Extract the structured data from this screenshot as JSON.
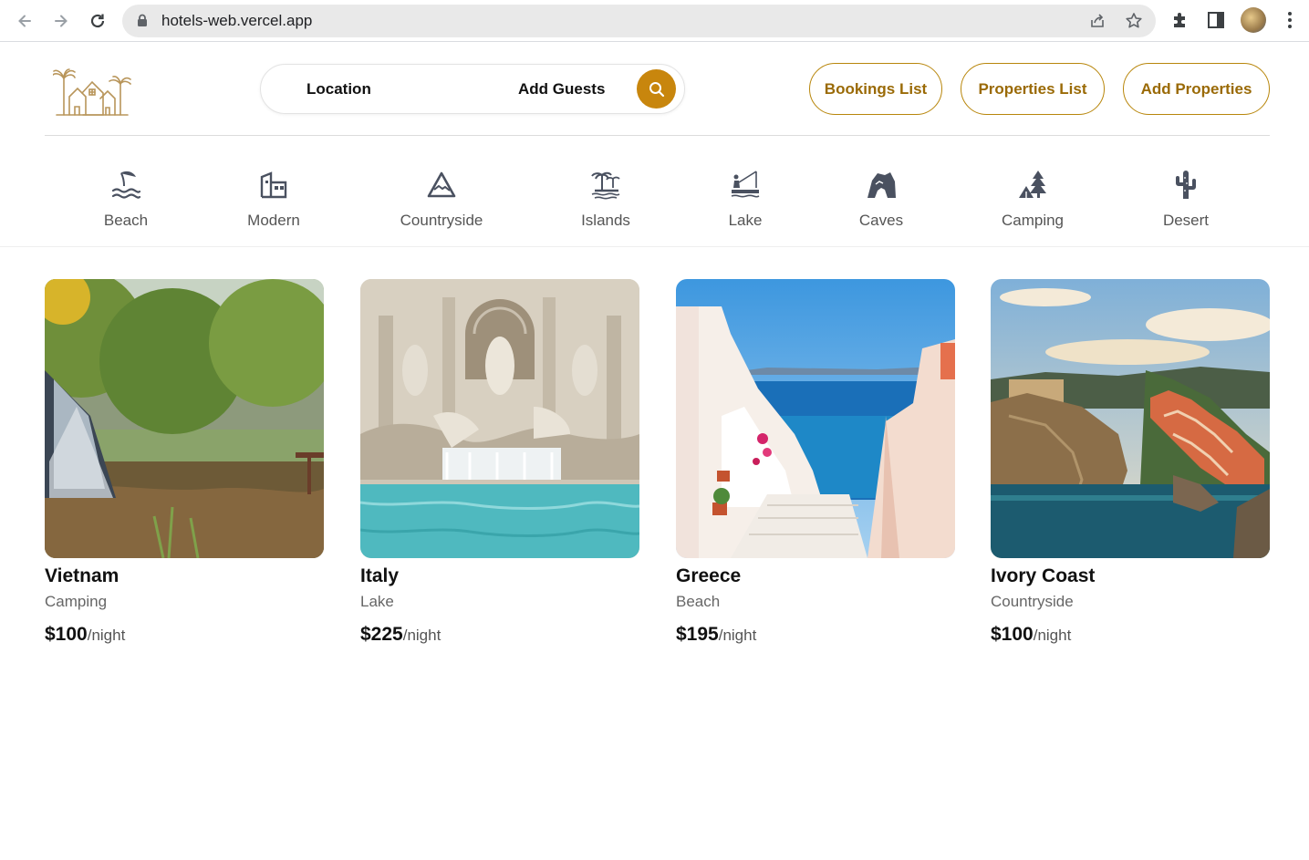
{
  "browser": {
    "url": "hotels-web.vercel.app"
  },
  "header": {
    "search": {
      "location_label": "Location",
      "guests_label": "Add Guests"
    },
    "buttons": {
      "bookings": "Bookings List",
      "properties": "Properties List",
      "add": "Add Properties"
    }
  },
  "categories": [
    {
      "label": "Beach",
      "icon": "beach-umbrella-icon"
    },
    {
      "label": "Modern",
      "icon": "modern-building-icon"
    },
    {
      "label": "Countryside",
      "icon": "mountain-icon"
    },
    {
      "label": "Islands",
      "icon": "island-palm-icon"
    },
    {
      "label": "Lake",
      "icon": "lake-fishing-icon"
    },
    {
      "label": "Caves",
      "icon": "cave-icon"
    },
    {
      "label": "Camping",
      "icon": "tent-tree-icon"
    },
    {
      "label": "Desert",
      "icon": "cactus-icon"
    }
  ],
  "listings": [
    {
      "title": "Vietnam",
      "category": "Camping",
      "price": "$100",
      "unit": "/night"
    },
    {
      "title": "Italy",
      "category": "Lake",
      "price": "$225",
      "unit": "/night"
    },
    {
      "title": "Greece",
      "category": "Beach",
      "price": "$195",
      "unit": "/night"
    },
    {
      "title": "Ivory Coast",
      "category": "Countryside",
      "price": "$100",
      "unit": "/night"
    }
  ],
  "colors": {
    "accent": "#c8860d",
    "accent_text": "#9a6a06",
    "icon": "#4a5160"
  }
}
